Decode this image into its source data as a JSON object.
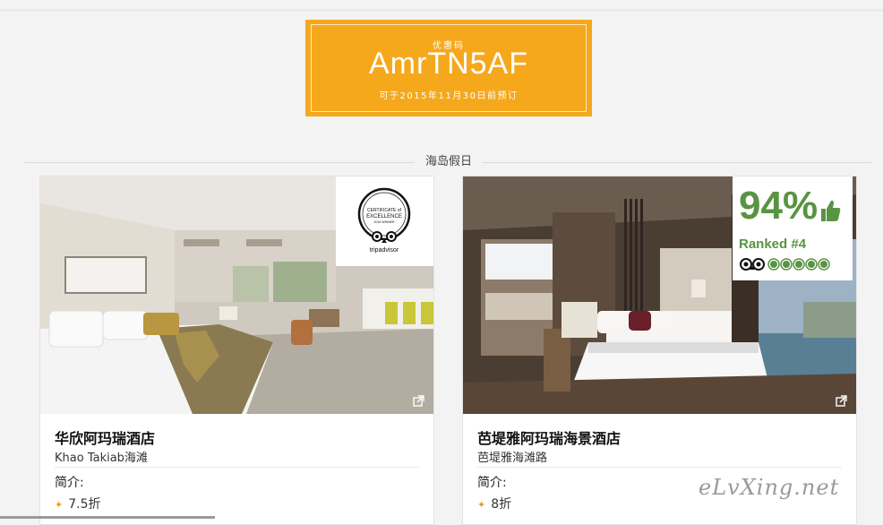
{
  "coupon": {
    "label": "优惠码",
    "code": "AmrTN5AF",
    "note": "可于2015年11月30日前预订"
  },
  "section": {
    "title": "海岛假日"
  },
  "hotels": [
    {
      "name": "华欣阿玛瑞酒店",
      "location": "Khao Takiab海滩",
      "intro_label": "简介:",
      "discount": "7.5折",
      "badge": {
        "type": "certificate",
        "line1": "CERTIFICATE of",
        "line2": "EXCELLENCE",
        "line3": "2015 WINNER",
        "brand": "tripadvisor"
      }
    },
    {
      "name": "芭堤雅阿玛瑞海景酒店",
      "location": "芭堤雅海滩路",
      "intro_label": "简介:",
      "discount": "8折",
      "badge": {
        "type": "ranking",
        "percent": "94%",
        "ranked": "Ranked #4",
        "rating_circles": 5
      }
    }
  ],
  "colors": {
    "coupon_bg": "#f6a81c",
    "tripadvisor_green": "#589442",
    "bullet_orange": "#f39b1c"
  },
  "icons": [
    "external-link-icon",
    "thumbs-up-icon",
    "tripadvisor-owl-icon",
    "rating-circle-icon"
  ],
  "watermark": "eLvXing.net"
}
